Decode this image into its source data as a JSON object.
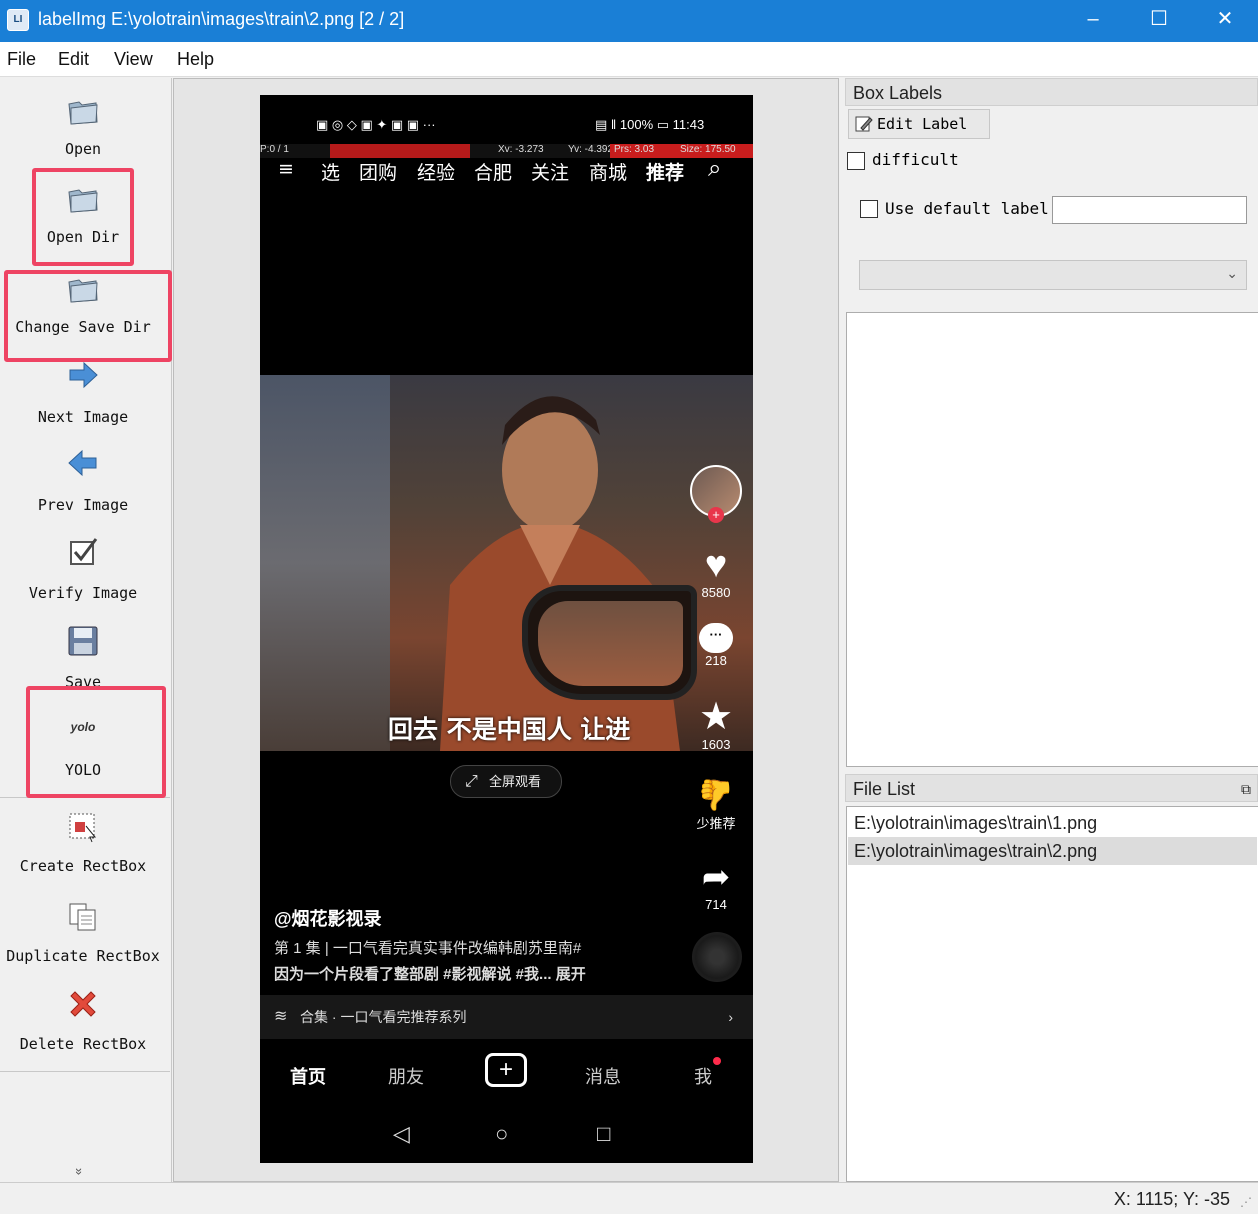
{
  "window": {
    "app_icon_text": "LI",
    "title": "labelImg E:\\yolotrain\\images\\train\\2.png [2 / 2]",
    "minimize": "–",
    "maximize": "☐",
    "close": "✕"
  },
  "menu": [
    "File",
    "Edit",
    "View",
    "Help"
  ],
  "toolbar": {
    "open": "Open",
    "open_dir": "Open Dir",
    "change_save_dir": "Change Save Dir",
    "next_image": "Next Image",
    "prev_image": "Prev Image",
    "verify_image": "Verify Image",
    "save": "Save",
    "yolo_icon_text": "yolo",
    "yolo": "YOLO",
    "create_rectbox": "Create RectBox",
    "duplicate_rectbox": "Duplicate RectBox",
    "delete_rectbox": "Delete RectBox",
    "more": "»"
  },
  "highlight_color": "#ee4463",
  "phone": {
    "status_left": "▣ ◎ ◇ ▣ ✦ ▣ ▣ ···",
    "status_right": "▤ ‖ 100% ▭ 11:43",
    "debug": {
      "p": "P:0 / 1",
      "xv": "Xv: -3.273",
      "yv": "Yv: -4.392",
      "prs": "Prs: 3.03",
      "size": "Size: 175.50"
    },
    "tabs": [
      "≡",
      "选",
      "团购",
      "经验",
      "合肥",
      "关注",
      "商城",
      "推荐",
      "⌕"
    ],
    "subtitle": "回去 不是中国人 让进",
    "likes": "8580",
    "comments": "218",
    "favorites": "1603",
    "not_recommend": "少推荐",
    "shares": "714",
    "fullscreen": "全屏观看",
    "author": "@烟花影视录",
    "desc_line1": "第 1 集 | 一口气看完真实事件改编韩剧苏里南#",
    "desc_line2": "因为一个片段看了整部剧 #影视解说 #我... 展开",
    "collection": "合集 · 一口气看完推荐系列",
    "nav": [
      "首页",
      "朋友",
      "+",
      "消息",
      "我"
    ],
    "sysnav": [
      "◁",
      "○",
      "□"
    ]
  },
  "box_labels": {
    "title": "Box Labels",
    "edit_label": "Edit Label",
    "difficult": "difficult",
    "use_default_label": "Use default label",
    "default_label_value": ""
  },
  "file_list": {
    "title": "File List",
    "files": [
      "E:\\yolotrain\\images\\train\\1.png",
      "E:\\yolotrain\\images\\train\\2.png"
    ]
  },
  "status": {
    "coords": "X: 1115; Y: -35"
  }
}
